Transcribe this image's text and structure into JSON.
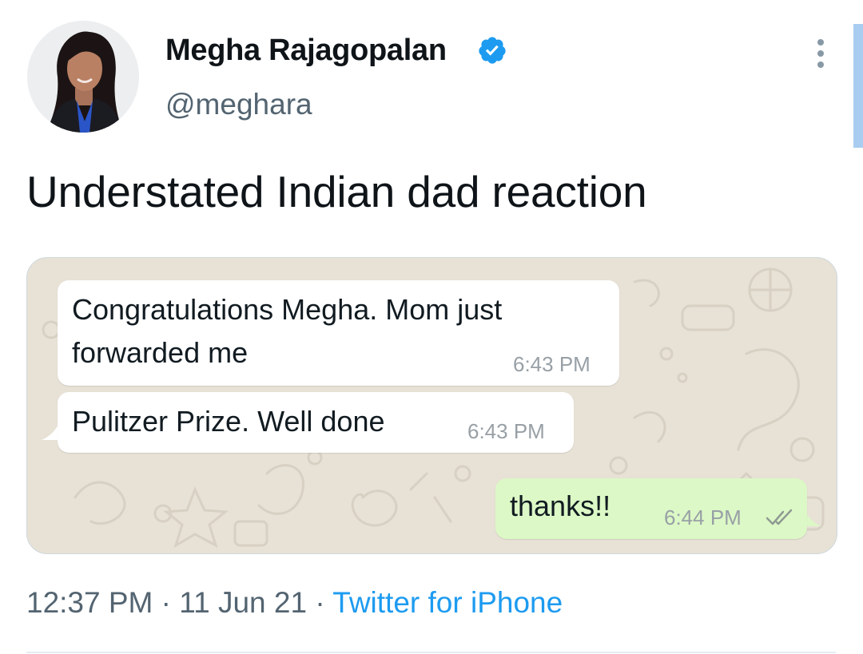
{
  "tweet": {
    "author": {
      "display_name": "Megha Rajagopalan",
      "handle": "@meghara",
      "verified": true
    },
    "text": "Understated Indian dad reaction",
    "meta": {
      "time": "12:37 PM",
      "separator": "·",
      "date": "11 Jun 21",
      "source": "Twitter for iPhone"
    }
  },
  "chat": {
    "messages": [
      {
        "direction": "incoming",
        "lines": [
          "Congratulations Megha. Mom just",
          "forwarded me"
        ],
        "time": "6:43 PM"
      },
      {
        "direction": "incoming",
        "lines": [
          "Pulitzer Prize. Well done"
        ],
        "time": "6:43 PM"
      },
      {
        "direction": "outgoing",
        "lines": [
          "thanks!!"
        ],
        "time": "6:44 PM",
        "status": "read"
      }
    ]
  },
  "icons": {
    "verified": "verified-badge-icon",
    "more": "more-vertical-icon",
    "read_receipt": "double-check-icon"
  },
  "colors": {
    "verified": "#1d9bf0",
    "link": "#1d9bf0",
    "outgoing_bubble": "#dcf8c6",
    "incoming_bubble": "#ffffff",
    "chat_background": "#e7e1d6"
  }
}
